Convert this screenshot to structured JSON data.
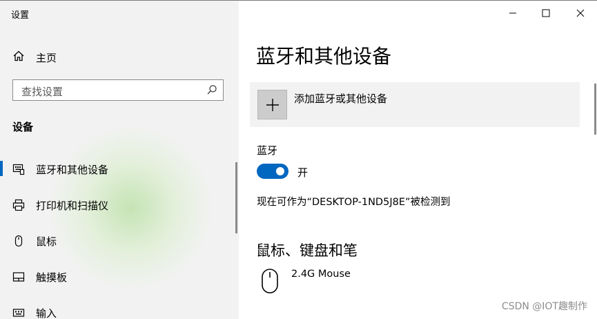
{
  "window": {
    "title": "设置"
  },
  "sidebar": {
    "home_label": "主页",
    "search_placeholder": "查找设置",
    "section_title": "设备",
    "items": [
      {
        "label": "蓝牙和其他设备",
        "icon": "bluetooth-devices-icon",
        "selected": true
      },
      {
        "label": "打印机和扫描仪",
        "icon": "printer-icon",
        "selected": false
      },
      {
        "label": "鼠标",
        "icon": "mouse-icon",
        "selected": false
      },
      {
        "label": "触摸板",
        "icon": "touchpad-icon",
        "selected": false
      },
      {
        "label": "输入",
        "icon": "keyboard-icon",
        "selected": false
      }
    ]
  },
  "main": {
    "title": "蓝牙和其他设备",
    "add_device_label": "添加蓝牙或其他设备",
    "bluetooth": {
      "label": "蓝牙",
      "state_label": "开",
      "on": true
    },
    "discoverable_text": "现在可作为“DESKTOP-1ND5J8E”被检测到",
    "devices_section_title": "鼠标、键盘和笔",
    "devices": [
      {
        "name": "2.4G Mouse",
        "icon": "mouse-icon"
      }
    ]
  },
  "watermark": "CSDN @IOT趣制作",
  "colors": {
    "accent": "#0067c0",
    "sidebar_bg": "#f2f2f2",
    "tile_bg": "#f2f2f2"
  }
}
